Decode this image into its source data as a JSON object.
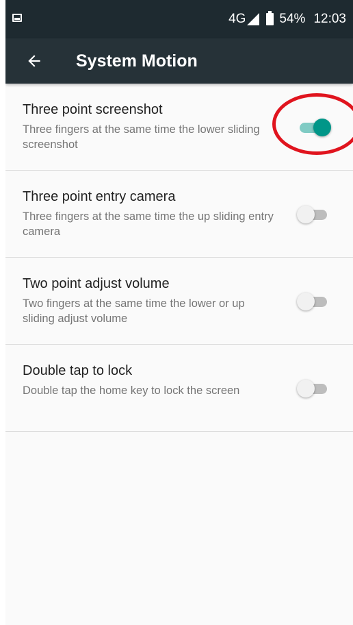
{
  "status_bar": {
    "network": "4G",
    "battery": "54%",
    "time": "12:03",
    "icons": [
      "notification-icon",
      "signal-icon",
      "battery-icon"
    ]
  },
  "app_bar": {
    "back_icon": "arrow-left-icon",
    "title": "System Motion"
  },
  "settings": [
    {
      "title": "Three point screenshot",
      "description": "Three fingers at the same time the lower sliding screenshot",
      "enabled": true
    },
    {
      "title": "Three point entry camera",
      "description": "Three fingers at the same time the up sliding entry camera",
      "enabled": false
    },
    {
      "title": "Two point adjust volume",
      "description": "Two fingers at the same time the lower or up sliding adjust volume",
      "enabled": false
    },
    {
      "title": "Double tap to lock",
      "description": "Double tap the home key to lock the screen",
      "enabled": false
    }
  ],
  "colors": {
    "status_bar": "#1e2a30",
    "app_bar": "#263238",
    "toggle_on_thumb": "#009688",
    "toggle_on_track": "#80cbc4",
    "toggle_off_thumb": "#f1f1f1",
    "toggle_off_track": "#bdbdbd",
    "annotation": "#e0141e"
  }
}
